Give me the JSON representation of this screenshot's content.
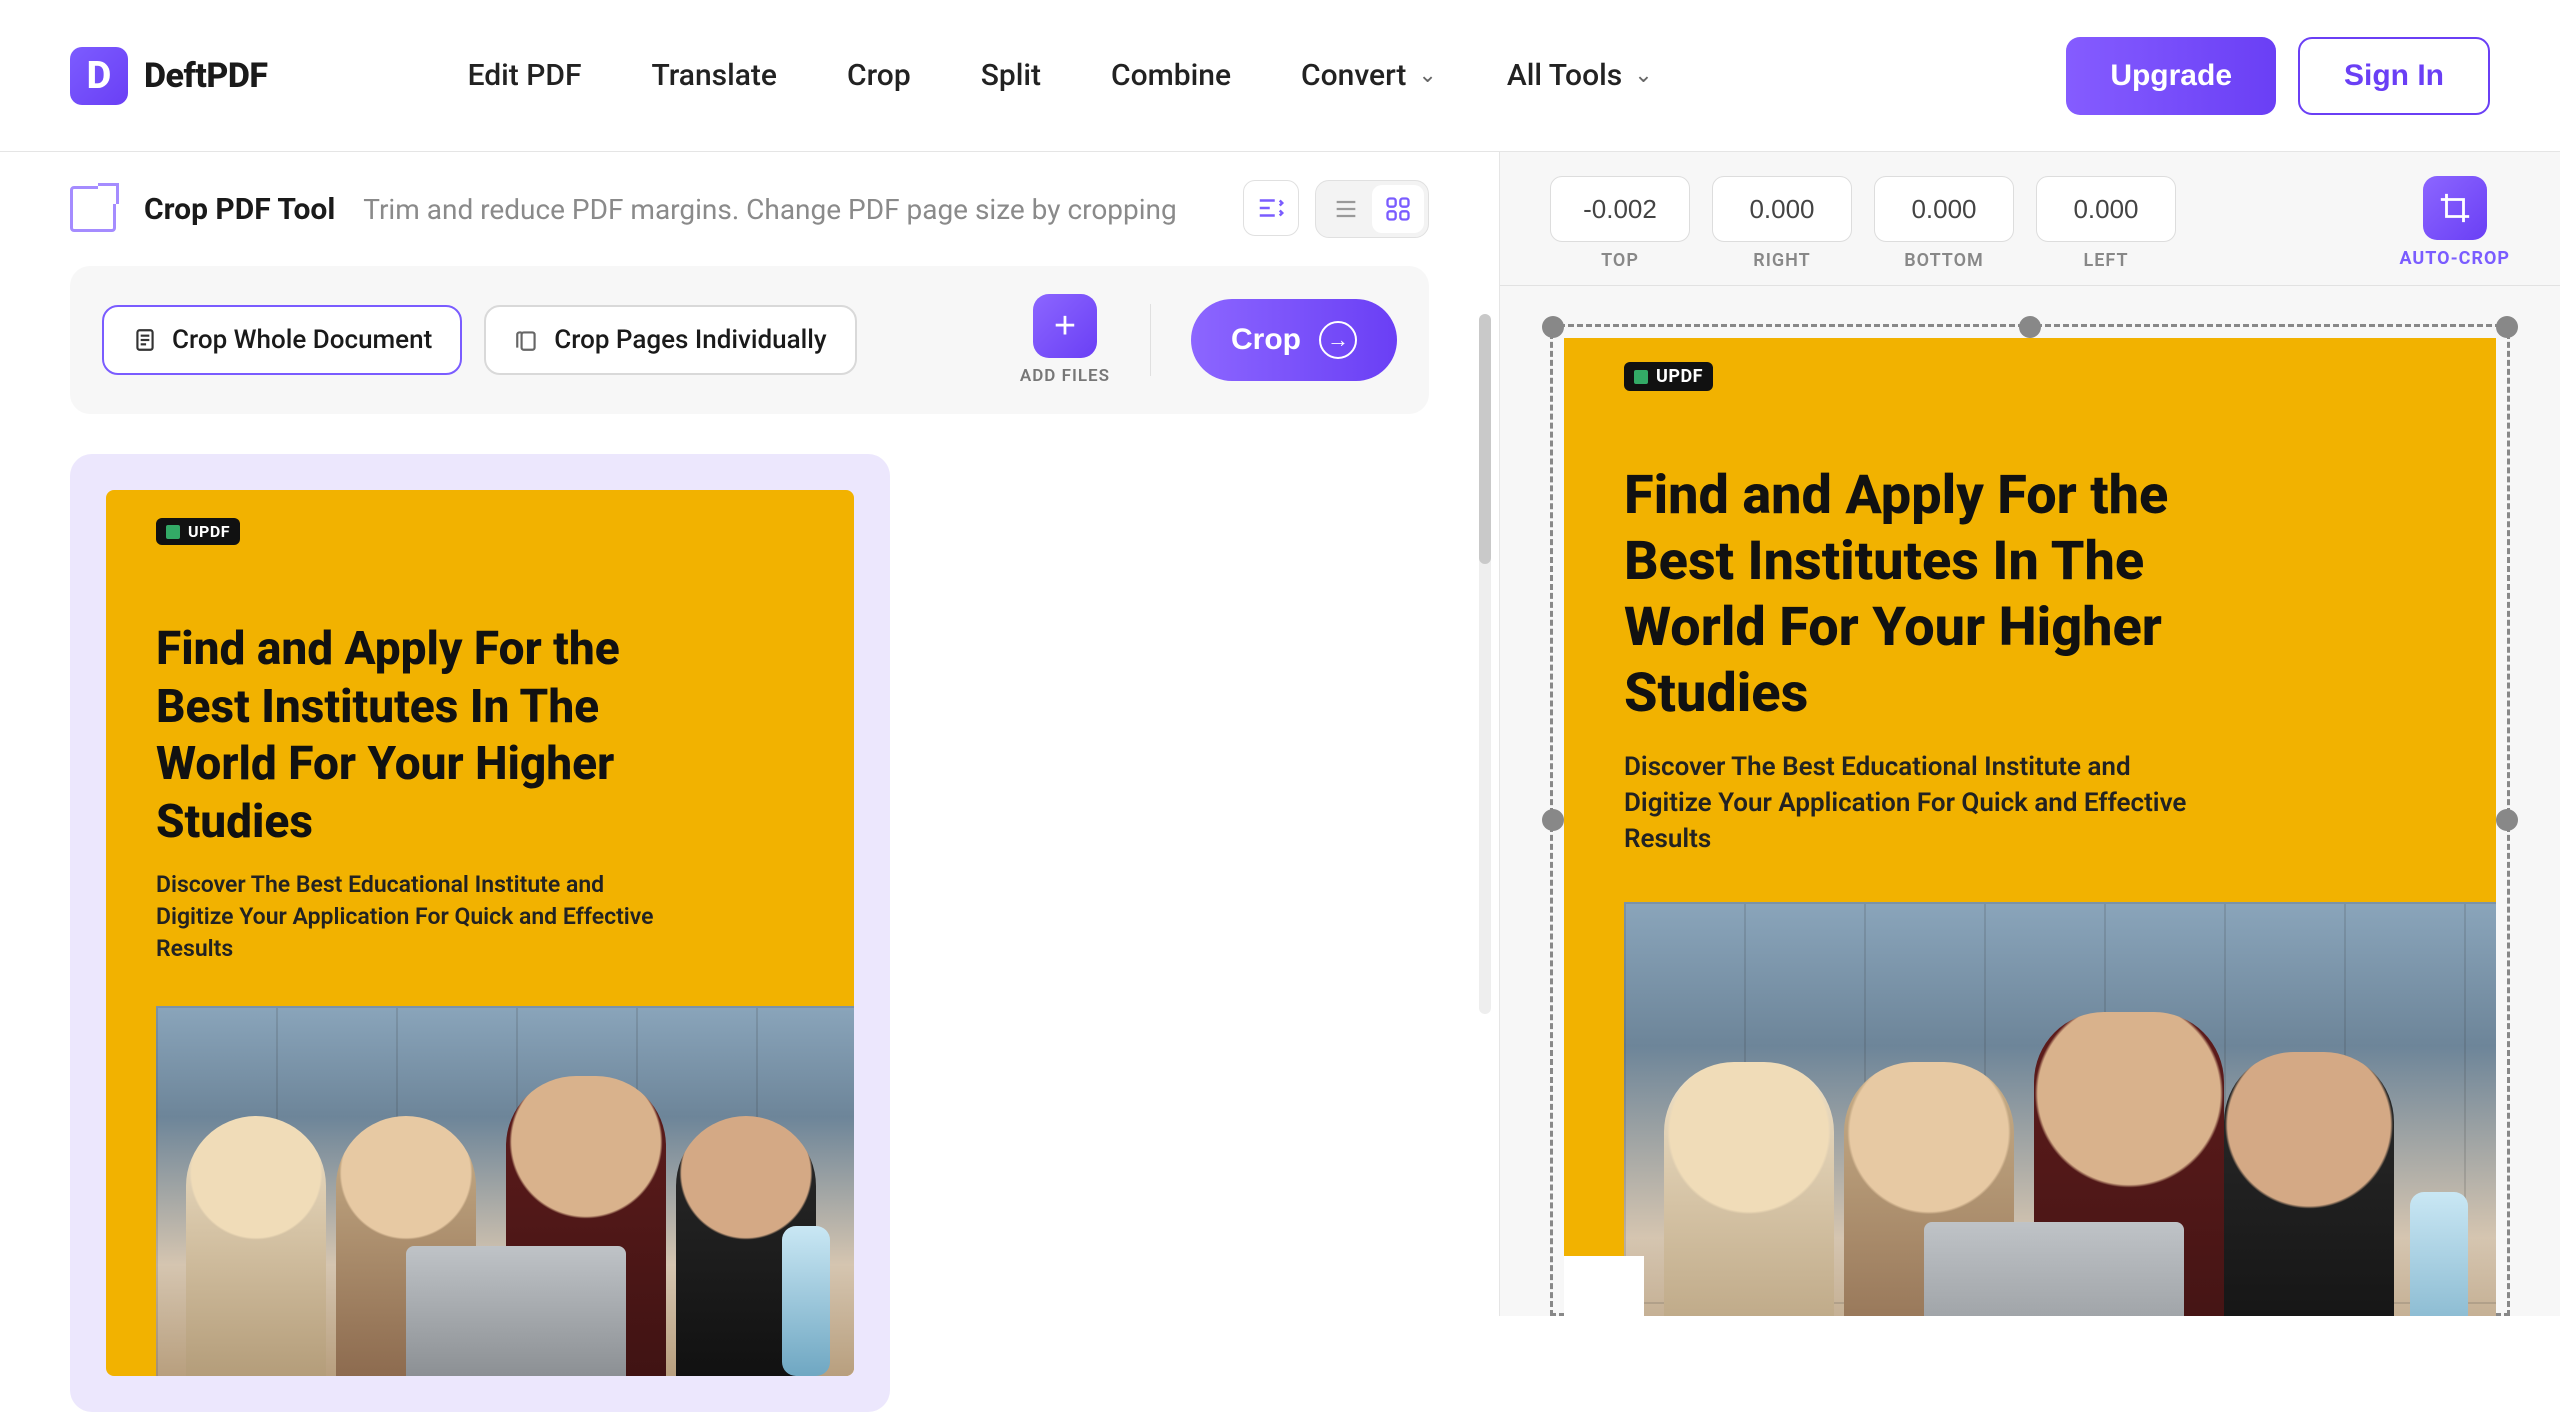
{
  "brand": {
    "name": "DeftPDF",
    "mark": "D"
  },
  "nav": {
    "items": [
      "Edit PDF",
      "Translate",
      "Crop",
      "Split",
      "Combine"
    ],
    "convert": "Convert",
    "alltools": "All Tools"
  },
  "header_buttons": {
    "upgrade": "Upgrade",
    "signin": "Sign In"
  },
  "tool": {
    "title": "Crop PDF Tool",
    "subtitle": "Trim and reduce PDF margins. Change PDF page size by cropping"
  },
  "options": {
    "crop_whole": "Crop Whole Document",
    "crop_pages": "Crop Pages Individually",
    "add_files": "ADD FILES",
    "crop": "Crop"
  },
  "doc": {
    "brand": "UPDF",
    "heading": "Find and Apply For the Best Institutes In The World For Your Higher Studies",
    "sub": "Discover The Best Educational Institute and Digitize Your Application For Quick and Effective Results"
  },
  "crop_values": {
    "top": {
      "value": "-0.002",
      "label": "TOP"
    },
    "right": {
      "value": "0.000",
      "label": "RIGHT"
    },
    "bottom": {
      "value": "0.000",
      "label": "BOTTOM"
    },
    "left": {
      "value": "0.000",
      "label": "LEFT"
    }
  },
  "autocrop": "AUTO-CROP"
}
